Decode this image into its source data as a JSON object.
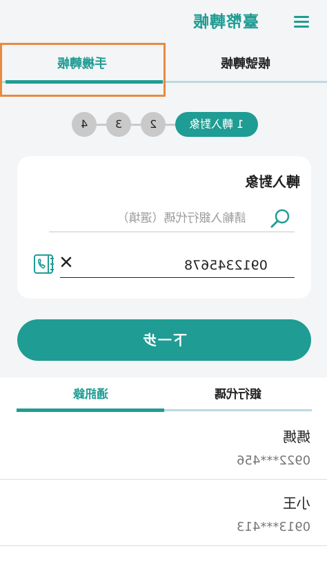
{
  "header": {
    "title": "臺幣轉帳",
    "menu_icon": "hamburger-menu-icon"
  },
  "tabs": [
    {
      "label": "手機轉帳",
      "active": true
    },
    {
      "label": "帳號轉帳",
      "active": false
    }
  ],
  "steps": {
    "current_label": "1 轉入對象",
    "items": [
      "2",
      "3",
      "4"
    ]
  },
  "form": {
    "heading": "轉入對象",
    "bank_placeholder": "請輸入銀行代碼（選填）",
    "phone_value": "0912345678"
  },
  "next_button": "下一步",
  "bottom_tabs": [
    {
      "label": "通訊錄",
      "active": true
    },
    {
      "label": "銀行代碼",
      "active": false
    }
  ],
  "contacts": [
    {
      "name": "媽媽",
      "number": "0922***456"
    },
    {
      "name": "小王",
      "number": "0913***413"
    }
  ],
  "colors": {
    "accent": "#1f9c93",
    "highlight": "#e88a3e"
  }
}
